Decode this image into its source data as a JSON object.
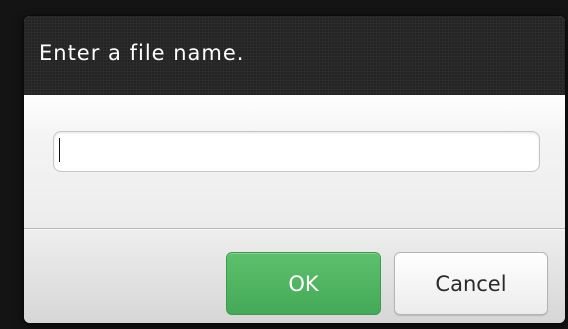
{
  "dialog": {
    "title": "Enter a file name.",
    "input_value": "",
    "input_placeholder": ""
  },
  "buttons": {
    "ok_label": "OK",
    "cancel_label": "Cancel"
  },
  "colors": {
    "header_bg": "#242424",
    "ok_green": "#4fb561",
    "cancel_bg": "#f7f7f7"
  }
}
